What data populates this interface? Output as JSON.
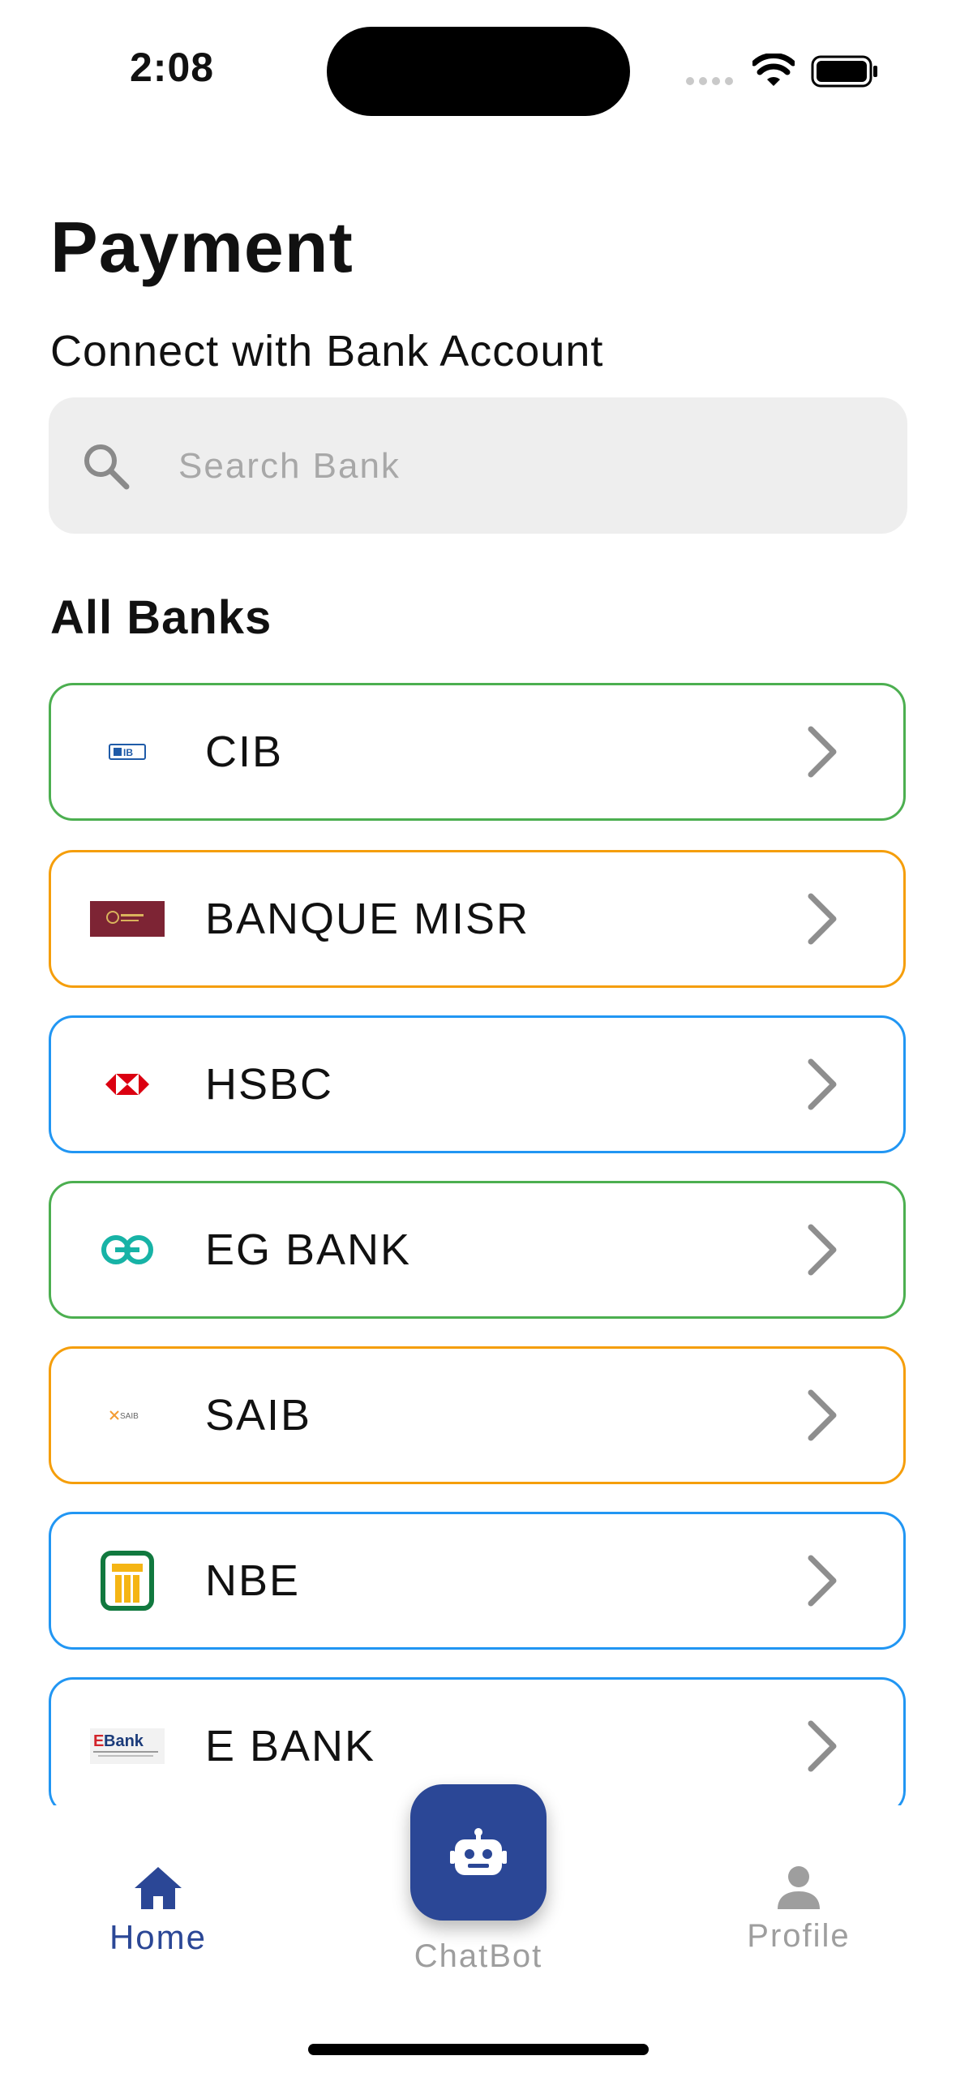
{
  "status_bar": {
    "time": "2:08"
  },
  "header": {
    "title": "Payment",
    "subtitle": "Connect with Bank Account"
  },
  "search": {
    "placeholder": "Search Bank",
    "value": ""
  },
  "section": {
    "title": "All Banks"
  },
  "banks": [
    {
      "name": "CIB",
      "border_color": "#4caf50",
      "logo": "cib-logo"
    },
    {
      "name": "BANQUE MISR",
      "border_color": "#f59e0b",
      "logo": "banque-misr-logo"
    },
    {
      "name": "HSBC",
      "border_color": "#2196f3",
      "logo": "hsbc-logo"
    },
    {
      "name": "EG BANK",
      "border_color": "#4caf50",
      "logo": "eg-bank-logo"
    },
    {
      "name": "SAIB",
      "border_color": "#f59e0b",
      "logo": "saib-logo"
    },
    {
      "name": "NBE",
      "border_color": "#2196f3",
      "logo": "nbe-logo"
    },
    {
      "name": "E BANK",
      "border_color": "#2196f3",
      "logo": "ebank-logo"
    }
  ],
  "bottom_nav": {
    "home": {
      "label": "Home",
      "icon": "home-icon",
      "active": true
    },
    "chatbot": {
      "label": "ChatBot",
      "icon": "robot-icon"
    },
    "profile": {
      "label": "Profile",
      "icon": "person-icon"
    }
  },
  "colors": {
    "accent": "#2b4796",
    "inactive": "#9e9e9e",
    "chevron": "#8e8e8e"
  }
}
